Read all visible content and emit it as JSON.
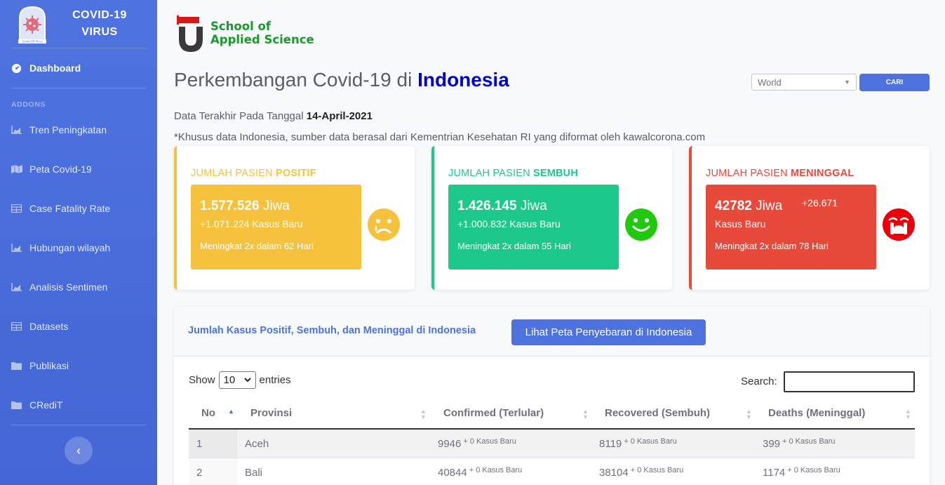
{
  "sidebar": {
    "brand": "COVID-19 VIRUS",
    "brand_logo_caption": "Covid-19 Virus",
    "heading": "ADDONS",
    "dashboard": "Dashboard",
    "items": [
      {
        "label": "Tren Peningkatan",
        "icon": "chart-area-icon"
      },
      {
        "label": "Peta Covid-19",
        "icon": "map-icon"
      },
      {
        "label": "Case Fatality Rate",
        "icon": "table-icon"
      },
      {
        "label": "Hubungan wilayah",
        "icon": "chart-area-icon"
      },
      {
        "label": "Analisis Sentimen",
        "icon": "chart-area-icon"
      },
      {
        "label": "Datasets",
        "icon": "table-icon"
      },
      {
        "label": "Publikasi",
        "icon": "folder-icon"
      },
      {
        "label": "CRediT",
        "icon": "folder-icon"
      }
    ],
    "toggle": "‹"
  },
  "header": {
    "logo_line1": "School of",
    "logo_line2": "Applied Science",
    "title_prefix": "Perkembangan Covid-19 di",
    "title_country": "Indonesia",
    "select_value": "World",
    "search_button": "CARI",
    "updated_prefix": "Data Terakhir Pada Tanggal",
    "updated_date": "14-April-2021",
    "note": "*Khusus data Indonesia, sumber data berasal dari Kementrian Kesehatan RI yang diformat oleh kawalcorona.com"
  },
  "cards": {
    "positif": {
      "title_prefix": "JUMLAH PASIEN",
      "title_bold": "POSITIF",
      "value": "1.577.526",
      "unit": "Jiwa",
      "new": "+1.071.224 Kasus Baru",
      "trend": "Meningkat 2x dalam 62 Hari",
      "color": "#f6c23e",
      "icon": "sad-tear-icon"
    },
    "sembuh": {
      "title_prefix": "JUMLAH PASIEN",
      "title_bold": "SEMBUH",
      "value": "1.426.145",
      "unit": "Jiwa",
      "new": "+1.000.832 Kasus Baru",
      "trend": "Meningkat 2x dalam 55 Hari",
      "color": "#1cc88a",
      "icon": "smile-icon"
    },
    "meninggal": {
      "title_prefix": "JUMLAH PASIEN",
      "title_bold": "MENINGGAL",
      "value": "42782",
      "unit": "Jiwa",
      "new_count": "+26.671",
      "new_label": "Kasus Baru",
      "trend": "Meningkat 2x dalam 78 Hari",
      "color": "#e74a3b",
      "icon": "crying-icon"
    }
  },
  "table_section": {
    "title": "Jumlah Kasus Positif, Sembuh, dan Meninggal di Indonesia",
    "map_button": "Lihat Peta Penyebaran di Indonesia",
    "show_label": "Show",
    "entries_value": "10",
    "entries_label": "entries",
    "search_label": "Search:",
    "columns": [
      "No",
      "Provinsi",
      "Confirmed (Terlular)",
      "Recovered (Sembuh)",
      "Deaths (Meninggal)"
    ],
    "rows": [
      {
        "no": "1",
        "provinsi": "Aceh",
        "confirmed": "9946",
        "recovered": "8119",
        "deaths": "399",
        "new": "+ 0 Kasus Baru"
      },
      {
        "no": "2",
        "provinsi": "Bali",
        "confirmed": "40844",
        "recovered": "38104",
        "deaths": "1174",
        "new": "+ 0 Kasus Baru"
      }
    ]
  }
}
